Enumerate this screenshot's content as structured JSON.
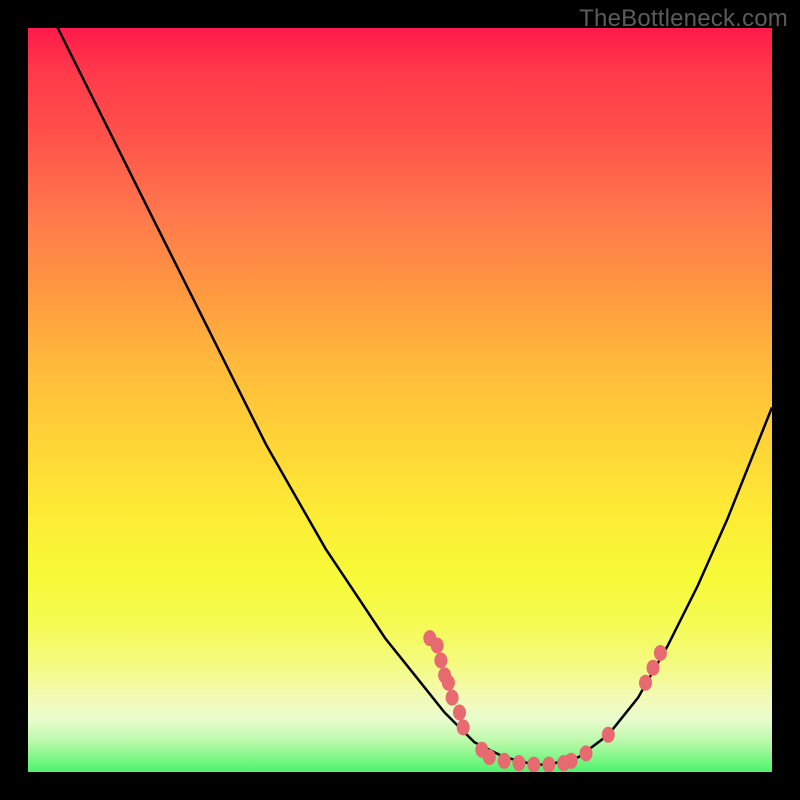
{
  "watermark": "TheBottleneck.com",
  "colors": {
    "background": "#000000",
    "curve": "#000000",
    "marker": "#e66a6f",
    "watermark": "#5b5b5b"
  },
  "chart_data": {
    "type": "line",
    "title": "",
    "xlabel": "",
    "ylabel": "",
    "xlim": [
      0,
      100
    ],
    "ylim": [
      0,
      100
    ],
    "grid": false,
    "legend": false,
    "series": [
      {
        "name": "bottleneck-curve",
        "x": [
          0,
          4,
          8,
          12,
          16,
          20,
          24,
          28,
          32,
          36,
          40,
          44,
          48,
          52,
          56,
          58,
          60,
          62,
          64,
          66,
          68,
          70,
          74,
          78,
          82,
          86,
          90,
          94,
          98,
          100
        ],
        "y": [
          108,
          100,
          92,
          84,
          76,
          68,
          60,
          52,
          44,
          37,
          30,
          24,
          18,
          13,
          8,
          6,
          4,
          3,
          2,
          1.5,
          1,
          1,
          2,
          5,
          10,
          17,
          25,
          34,
          44,
          49
        ]
      }
    ],
    "markers": [
      {
        "x": 54,
        "y": 18
      },
      {
        "x": 55,
        "y": 17
      },
      {
        "x": 55.5,
        "y": 15
      },
      {
        "x": 56,
        "y": 13
      },
      {
        "x": 56.5,
        "y": 12
      },
      {
        "x": 57,
        "y": 10
      },
      {
        "x": 58,
        "y": 8
      },
      {
        "x": 58.5,
        "y": 6
      },
      {
        "x": 61,
        "y": 3
      },
      {
        "x": 62,
        "y": 2
      },
      {
        "x": 64,
        "y": 1.5
      },
      {
        "x": 66,
        "y": 1.2
      },
      {
        "x": 68,
        "y": 1
      },
      {
        "x": 70,
        "y": 1
      },
      {
        "x": 72,
        "y": 1.2
      },
      {
        "x": 73,
        "y": 1.5
      },
      {
        "x": 75,
        "y": 2.5
      },
      {
        "x": 78,
        "y": 5
      },
      {
        "x": 83,
        "y": 12
      },
      {
        "x": 84,
        "y": 14
      },
      {
        "x": 85,
        "y": 16
      }
    ]
  }
}
